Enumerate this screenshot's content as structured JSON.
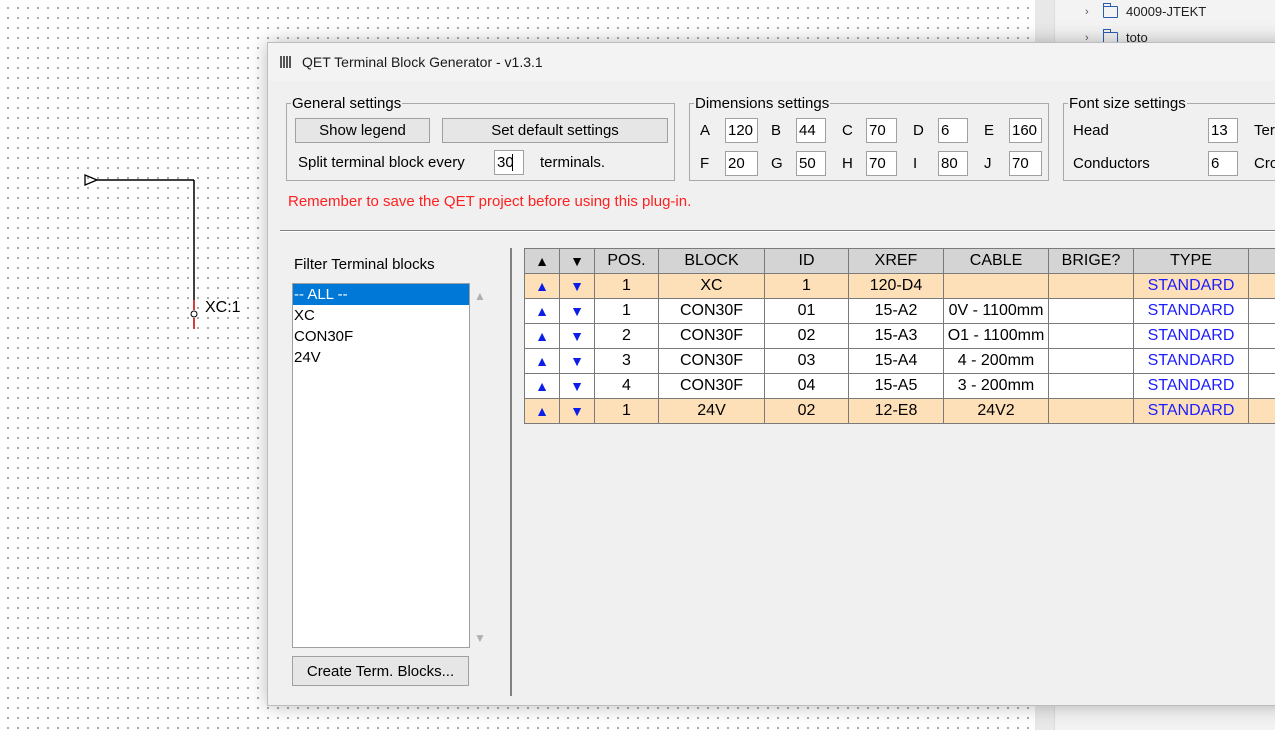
{
  "canvas": {
    "element_label": "XC:1"
  },
  "project_tree": {
    "items": [
      {
        "label": "40009-JTEKT"
      },
      {
        "label": "toto"
      }
    ]
  },
  "dialog": {
    "title": "QET Terminal Block Generator - v1.3.1",
    "general": {
      "legend": "General settings",
      "show_legend_label": "Show legend",
      "set_default_label": "Set default settings",
      "split_label": "Split terminal block every",
      "split_value": "30",
      "split_suffix": "terminals."
    },
    "dimensions": {
      "legend": "Dimensions settings",
      "fields": [
        {
          "label": "A",
          "value": "120"
        },
        {
          "label": "B",
          "value": "44"
        },
        {
          "label": "C",
          "value": "70"
        },
        {
          "label": "D",
          "value": "6"
        },
        {
          "label": "E",
          "value": "160"
        },
        {
          "label": "F",
          "value": "20"
        },
        {
          "label": "G",
          "value": "50"
        },
        {
          "label": "H",
          "value": "70"
        },
        {
          "label": "I",
          "value": "80"
        },
        {
          "label": "J",
          "value": "70"
        }
      ]
    },
    "fonts": {
      "legend": "Font size settings",
      "head_label": "Head",
      "head_value": "13",
      "conductors_label": "Conductors",
      "conductors_value": "6",
      "right_label_1": "Ter",
      "right_label_2": "Cro"
    },
    "warning": "Remember to save the QET project before using this plug-in.",
    "filter": {
      "label": "Filter Terminal blocks",
      "items": [
        "-- ALL --",
        "XC",
        "CON30F",
        "24V"
      ],
      "selected": "-- ALL --"
    },
    "create_label": "Create Term. Blocks...",
    "table": {
      "columns": [
        "▲",
        "▼",
        "POS.",
        "BLOCK",
        "ID",
        "XREF",
        "CABLE",
        "BRIGE?",
        "TYPE"
      ],
      "rows": [
        {
          "pos": "1",
          "block": "XC",
          "id": "1",
          "xref": "120-D4",
          "cable": "",
          "brige": "",
          "type": "STANDARD",
          "highlight": true
        },
        {
          "pos": "1",
          "block": "CON30F",
          "id": "01",
          "xref": "15-A2",
          "cable": "0V - 1100mm",
          "brige": "",
          "type": "STANDARD",
          "highlight": false
        },
        {
          "pos": "2",
          "block": "CON30F",
          "id": "02",
          "xref": "15-A3",
          "cable": "O1 - 1100mm",
          "brige": "",
          "type": "STANDARD",
          "highlight": false
        },
        {
          "pos": "3",
          "block": "CON30F",
          "id": "03",
          "xref": "15-A4",
          "cable": "4 - 200mm",
          "brige": "",
          "type": "STANDARD",
          "highlight": false
        },
        {
          "pos": "4",
          "block": "CON30F",
          "id": "04",
          "xref": "15-A5",
          "cable": "3 - 200mm",
          "brige": "",
          "type": "STANDARD",
          "highlight": false
        },
        {
          "pos": "1",
          "block": "24V",
          "id": "02",
          "xref": "12-E8",
          "cable": "24V2",
          "brige": "",
          "type": "STANDARD",
          "highlight": true
        }
      ],
      "up_arrow": "▲",
      "down_arrow": "▼"
    },
    "colors": {
      "highlight_row": "#fde0b8",
      "type_text": "#1c1cff",
      "warning_text": "#ff2020",
      "selection": "#0078d7"
    }
  }
}
